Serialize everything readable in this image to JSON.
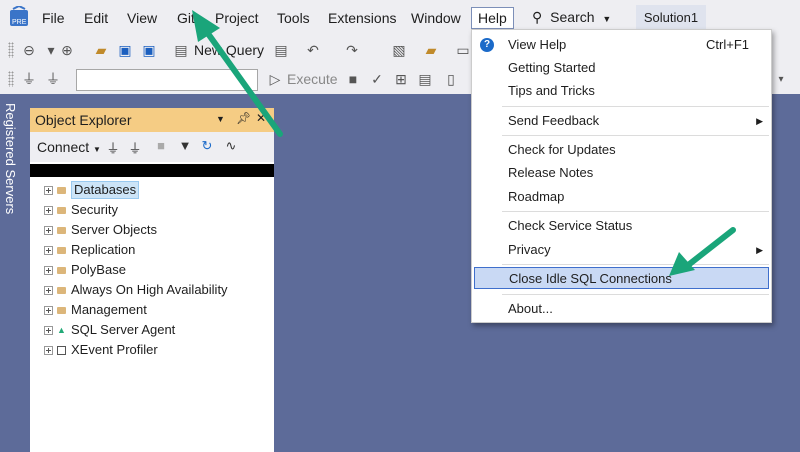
{
  "menubar": {
    "items": [
      "File",
      "Edit",
      "View",
      "Git",
      "Project",
      "Tools",
      "Extensions",
      "Window",
      "Help"
    ],
    "search_label": "Search",
    "solution_name": "Solution1"
  },
  "toolbar": {
    "new_query_label": "New Query",
    "execute_label": "Execute"
  },
  "left_rail": {
    "label": "Registered Servers"
  },
  "object_explorer": {
    "title": "Object Explorer",
    "connect_label": "Connect",
    "tree": [
      "Databases",
      "Security",
      "Server Objects",
      "Replication",
      "PolyBase",
      "Always On High Availability",
      "Management",
      "SQL Server Agent",
      "XEvent Profiler"
    ],
    "selected": "Databases"
  },
  "help_menu": {
    "view_help": "View Help",
    "view_help_shortcut": "Ctrl+F1",
    "getting_started": "Getting Started",
    "tips_and_tricks": "Tips and Tricks",
    "send_feedback": "Send Feedback",
    "check_updates": "Check for Updates",
    "release_notes": "Release Notes",
    "roadmap": "Roadmap",
    "check_service_status": "Check Service Status",
    "privacy": "Privacy",
    "close_idle": "Close Idle SQL Connections",
    "about": "About..."
  },
  "colors": {
    "annotation_arrow": "#1aa57a",
    "highlight": "#c9d9f4",
    "panel_header": "#f5cc84",
    "background": "#5d6b99"
  }
}
